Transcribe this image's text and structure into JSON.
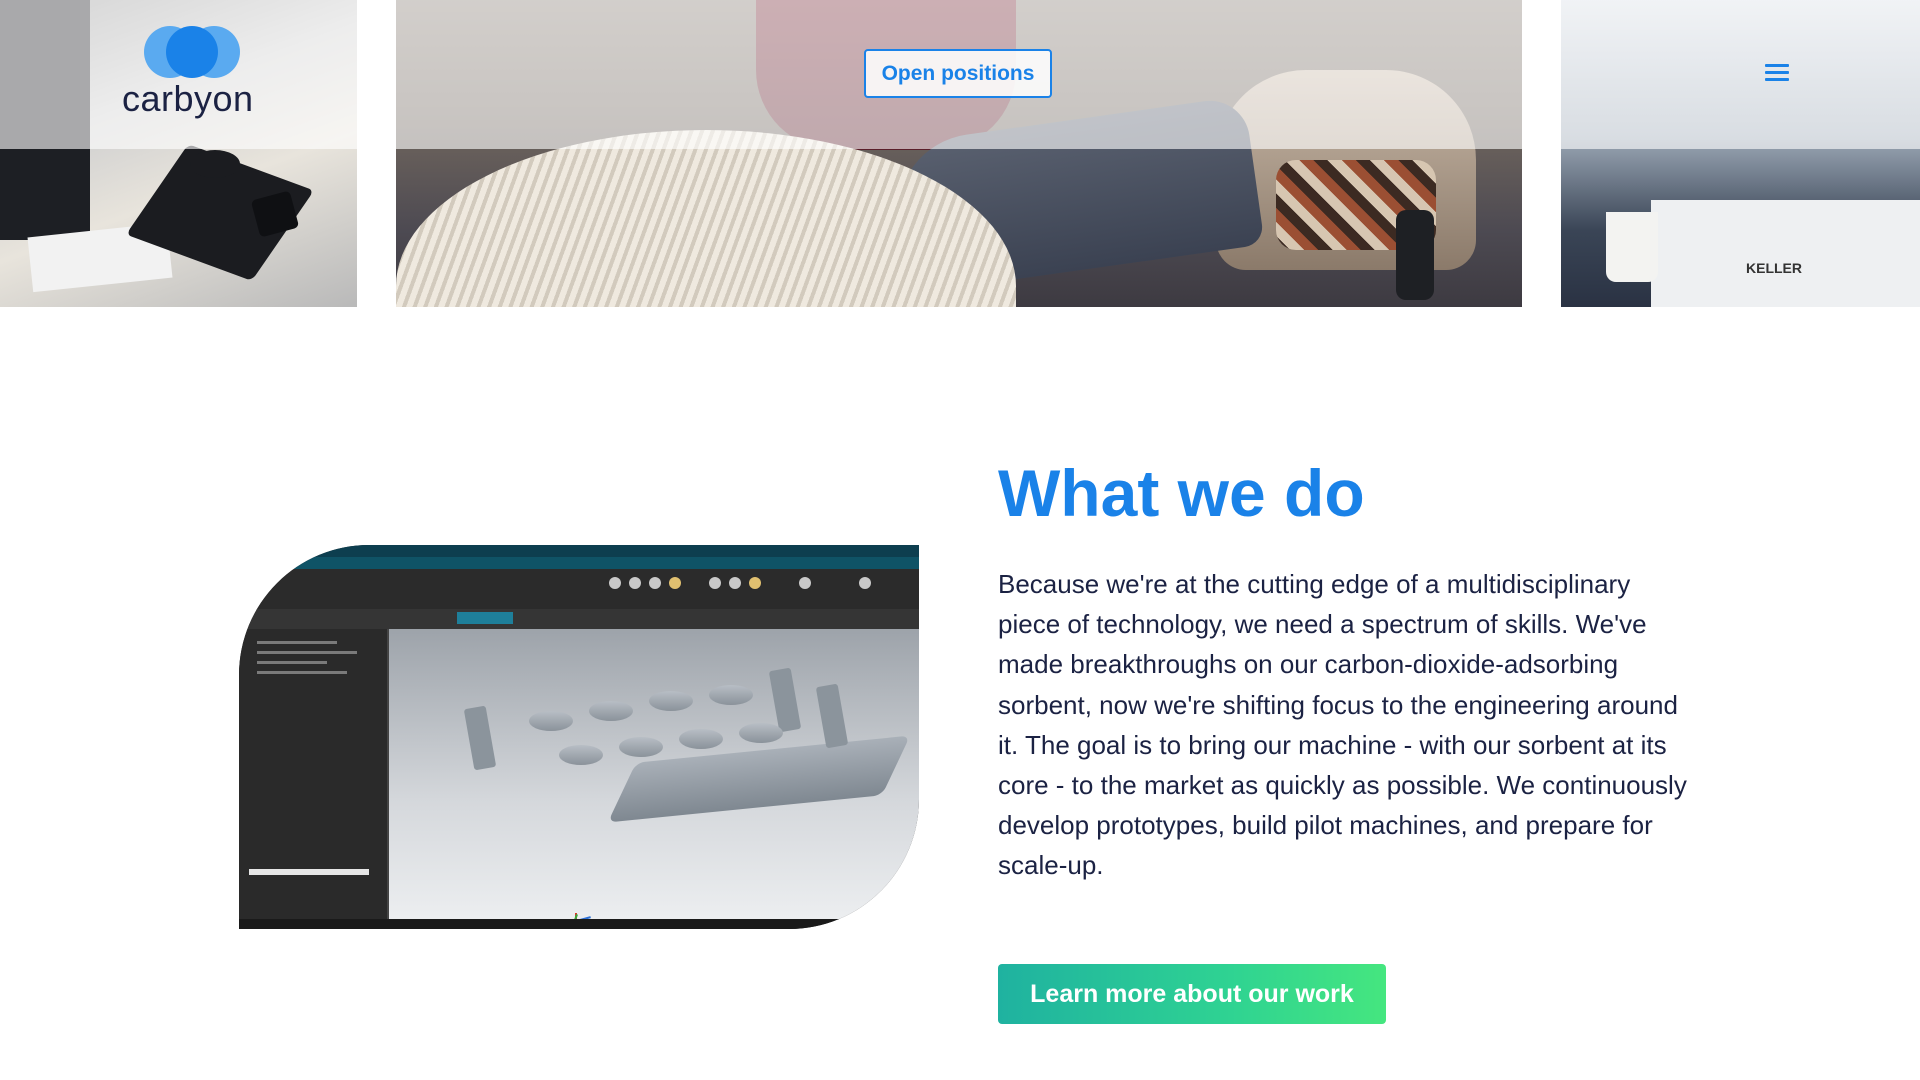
{
  "header": {
    "logo": {
      "text": "carbyon"
    },
    "open_positions_label": "Open positions",
    "menu_icon": "hamburger-menu-icon"
  },
  "photos": {
    "right_photo_brand": "KELLER"
  },
  "what_we_do": {
    "title": "What we do",
    "body": "Because we're at the cutting edge of a multidisciplinary piece of technology, we need a spectrum of skills. We've made breakthroughs on our carbon-dioxide-adsorbing sorbent, now we're shifting focus to the engineering around it. The goal is to bring our machine - with our sorbent at its core - to the market as quickly as possible. We continuously develop prototypes, build pilot machines, and prepare for scale-up.",
    "cta_label": "Learn more about our work"
  },
  "colors": {
    "brand_blue": "#1a82e8",
    "text_dark": "#1b2243",
    "cta_gradient_start": "#1fb2a0",
    "cta_gradient_end": "#45e67f"
  }
}
